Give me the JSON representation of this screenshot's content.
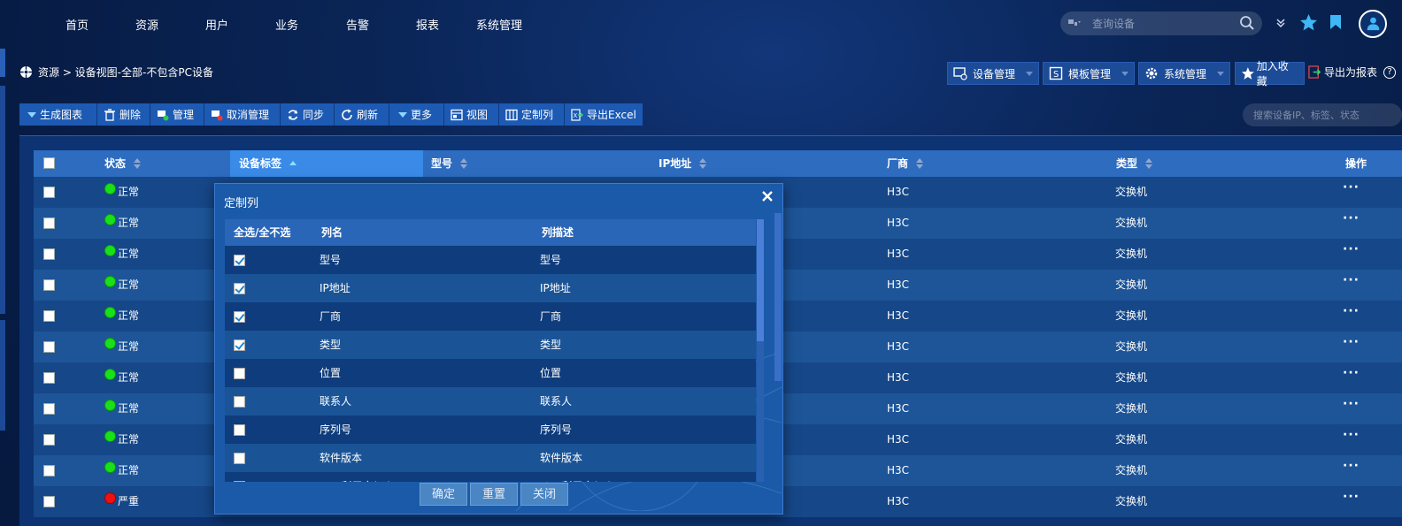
{
  "nav": {
    "items": [
      "首页",
      "资源",
      "用户",
      "业务",
      "告警",
      "报表",
      "系统管理"
    ],
    "search_placeholder": "查询设备"
  },
  "breadcrumb": {
    "text": "资源 > 设备视图-全部-不包含PC设备"
  },
  "right_tools": {
    "device_mgmt": "设备管理",
    "template_mgmt": "模板管理",
    "system_mgmt": "系统管理",
    "add_favorite": "加入收藏",
    "export_report": "导出为报表"
  },
  "toolbar": {
    "generate_chart": "生成图表",
    "delete": "删除",
    "manage": "管理",
    "unmanage": "取消管理",
    "sync": "同步",
    "refresh": "刷新",
    "more": "更多",
    "view": "视图",
    "custom_columns": "定制列",
    "export_excel": "导出Excel",
    "search_placeholder": "搜索设备IP、标签、状态"
  },
  "table": {
    "headers": {
      "status": "状态",
      "label": "设备标签",
      "model": "型号",
      "ip": "IP地址",
      "vendor": "厂商",
      "type": "类型",
      "action": "操作"
    },
    "rows": [
      {
        "status": "正常",
        "level": "ok",
        "vendor": "H3C",
        "type": "交换机",
        "action": "···"
      },
      {
        "status": "正常",
        "level": "ok",
        "vendor": "H3C",
        "type": "交换机",
        "action": "···"
      },
      {
        "status": "正常",
        "level": "ok",
        "vendor": "H3C",
        "type": "交换机",
        "action": "···"
      },
      {
        "status": "正常",
        "level": "ok",
        "vendor": "H3C",
        "type": "交换机",
        "action": "···"
      },
      {
        "status": "正常",
        "level": "ok",
        "vendor": "H3C",
        "type": "交换机",
        "action": "···"
      },
      {
        "status": "正常",
        "level": "ok",
        "vendor": "H3C",
        "type": "交换机",
        "action": "···"
      },
      {
        "status": "正常",
        "level": "ok",
        "vendor": "H3C",
        "type": "交换机",
        "action": "···"
      },
      {
        "status": "正常",
        "level": "ok",
        "vendor": "H3C",
        "type": "交换机",
        "action": "···"
      },
      {
        "status": "正常",
        "level": "ok",
        "vendor": "H3C",
        "type": "交换机",
        "action": "···"
      },
      {
        "status": "正常",
        "level": "ok",
        "vendor": "H3C",
        "type": "交换机",
        "action": "···"
      },
      {
        "status": "严重",
        "level": "critical",
        "vendor": "H3C",
        "type": "交换机",
        "action": "···"
      }
    ]
  },
  "modal": {
    "title": "定制列",
    "headers": {
      "select": "全选/全不选",
      "name": "列名",
      "desc": "列描述"
    },
    "rows": [
      {
        "name": "型号",
        "desc": "型号",
        "checked": true
      },
      {
        "name": "IP地址",
        "desc": "IP地址",
        "checked": true
      },
      {
        "name": "厂商",
        "desc": "厂商",
        "checked": true
      },
      {
        "name": "类型",
        "desc": "类型",
        "checked": true
      },
      {
        "name": "位置",
        "desc": "位置",
        "checked": false
      },
      {
        "name": "联系人",
        "desc": "联系人",
        "checked": false
      },
      {
        "name": "序列号",
        "desc": "序列号",
        "checked": false
      },
      {
        "name": "软件版本",
        "desc": "软件版本",
        "checked": false
      },
      {
        "name": "CPU利用率(%)",
        "desc": "CPU利用率(%)",
        "checked": false
      }
    ],
    "confirm": "确定",
    "reset": "重置",
    "close": "关闭"
  },
  "colors": {
    "status_ok": "#19e019",
    "status_critical": "#ee1111",
    "accent": "#1d5ab3"
  }
}
